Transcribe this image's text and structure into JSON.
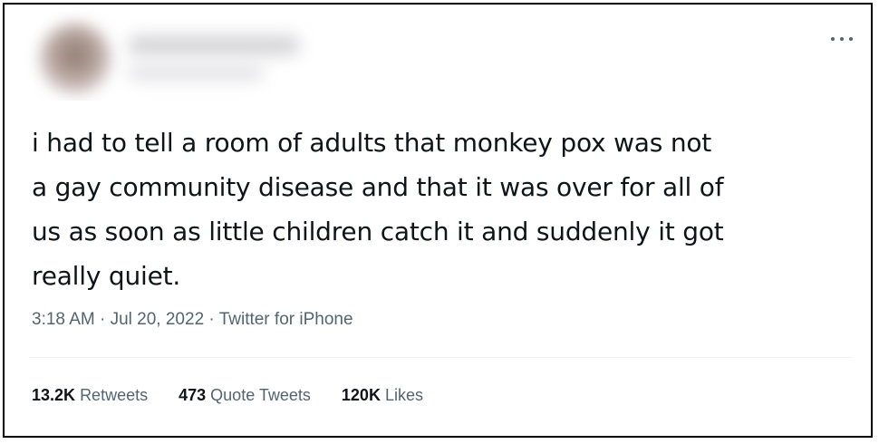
{
  "tweet": {
    "text": "i had to tell a room of adults that monkey pox was not\na gay community disease and that it was over for all of\nus as soon as little children catch it and suddenly it got\nreally quiet.",
    "time": "3:18 AM",
    "date": "Jul 20, 2022",
    "source": "Twitter for iPhone",
    "separator": " · "
  },
  "stats": {
    "retweets_count": "13.2K",
    "retweets_label": "Retweets",
    "quotes_count": "473",
    "quotes_label": "Quote Tweets",
    "likes_count": "120K",
    "likes_label": "Likes"
  },
  "icons": {
    "more": "more-horizontal-icon"
  },
  "colors": {
    "text": "#0f1419",
    "secondary": "#536471",
    "divider": "#eff3f4"
  }
}
